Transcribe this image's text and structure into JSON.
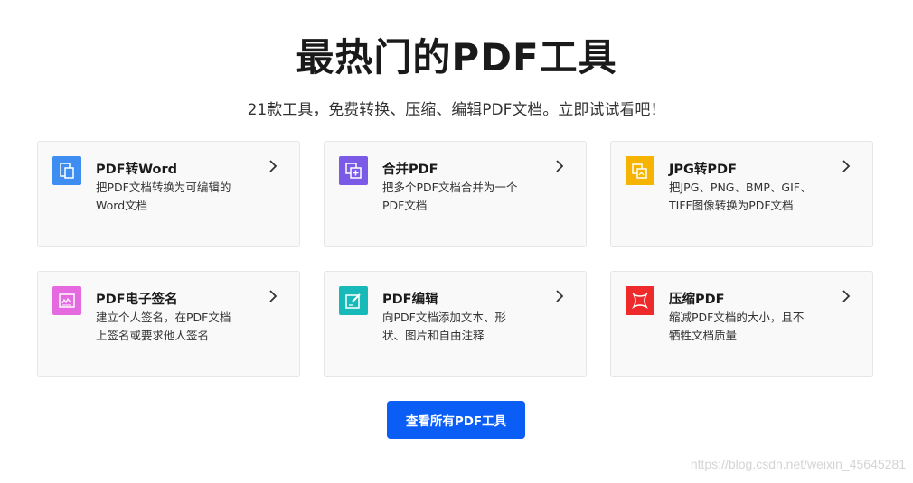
{
  "page": {
    "title": "最热门的PDF工具",
    "subtitle": "21款工具，免费转换、压缩、编辑PDF文档。立即试试看吧！"
  },
  "tools": [
    {
      "name": "PDF转Word",
      "desc_line1": "把PDF文档转换为可编辑的",
      "desc_line2": "Word文档",
      "icon": "word-doc-icon",
      "color": "#3d8ef0"
    },
    {
      "name": "合并PDF",
      "desc_line1": "把多个PDF文档合并为一个",
      "desc_line2": "PDF文档",
      "icon": "merge-icon",
      "color": "#7a5ae6"
    },
    {
      "name": "JPG转PDF",
      "desc_line1": "把JPG、PNG、BMP、GIF、",
      "desc_line2": "TIFF图像转换为PDF文档",
      "icon": "image-convert-icon",
      "color": "#f6b400"
    },
    {
      "name": "PDF电子签名",
      "desc_line1": "建立个人签名，在PDF文档",
      "desc_line2": "上签名或要求他人签名",
      "icon": "signature-icon",
      "color": "#e56ae0"
    },
    {
      "name": "PDF编辑",
      "desc_line1": "向PDF文档添加文本、形",
      "desc_line2": "状、图片和自由注释",
      "icon": "edit-icon",
      "color": "#17b9b9"
    },
    {
      "name": "压缩PDF",
      "desc_line1": "缩减PDF文档的大小，且不",
      "desc_line2": "牺牲文档质量",
      "icon": "compress-icon",
      "color": "#ee2a2a"
    }
  ],
  "cta": {
    "label": "查看所有PDF工具"
  },
  "watermark": "https://blog.csdn.net/weixin_45645281"
}
